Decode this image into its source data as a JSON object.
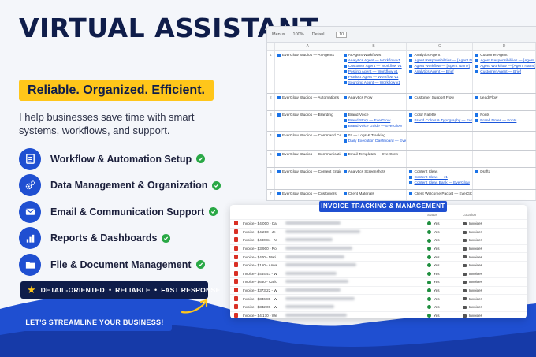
{
  "header": {
    "title": "VIRTUAL ASSISTANT",
    "tagline": "Reliable. Organized. Efficient.",
    "intro": "I help businesses save time with smart systems, workflows, and support."
  },
  "services": [
    {
      "label": "Workflow & Automation Setup",
      "icon": "checklist-icon"
    },
    {
      "label": "Data Management & Organization",
      "icon": "gears-icon"
    },
    {
      "label": "Email & Communication Support",
      "icon": "envelope-icon"
    },
    {
      "label": "Reports & Dashboards",
      "icon": "bar-chart-icon"
    },
    {
      "label": "File & Document Management",
      "icon": "folder-icon"
    }
  ],
  "qualities": [
    "DETAIL-ORIENTED",
    "RELIABLE",
    "FAST RESPONSE"
  ],
  "cta": "LET'S STREAMLINE YOUR BUSINESS!",
  "colors": {
    "navy": "#0f1d4a",
    "blue": "#1f4fd1",
    "yellow": "#ffc61a",
    "green": "#29a845"
  },
  "sheet": {
    "toolbar": [
      "Menus",
      "100%",
      "Defaul...",
      "10"
    ],
    "columns": [
      "A",
      "B",
      "C",
      "D"
    ],
    "rows": [
      {
        "num": "1",
        "cells": [
          [
            "EverGlow Studios — AI Agents"
          ],
          [
            "AI Agent Workflows",
            "Analytics Agent — Workflow v1",
            "Customer Agent — Workflow v1",
            "Posting Agent — Workflow v1",
            "Product Agent — Workflow v1",
            "Sourcing Agent — Workflow v1"
          ],
          [
            "Analytics Agent",
            "Agent Responsibilities — [Agent Name]",
            "Agent Workflow — [Agent Name]",
            "Analytics Agent — Brief"
          ],
          [
            "Customer Agent",
            "Agent Responsibilities — [Agent Name]",
            "Agent Workflow — [Agent Name]",
            "Customer Agent — Brief"
          ]
        ]
      },
      {
        "num": "2",
        "cells": [
          [
            "EverGlow Studios — Automations"
          ],
          [
            "Analytics Flow"
          ],
          [
            "Customer Support Flow"
          ],
          [
            "Lead Flow"
          ]
        ]
      },
      {
        "num": "3",
        "cells": [
          [
            "EverGlow Studios — Branding"
          ],
          [
            "Brand Voice",
            "Brand Story — EverGlow",
            "Brand Voice Guide — EverGlow"
          ],
          [
            "Color Palette",
            "Brand Colors & Typography — EverGlow"
          ],
          [
            "Fonts",
            "Brand Notes — Fonts"
          ]
        ]
      },
      {
        "num": "4",
        "cells": [
          [
            "EverGlow Studios — Command Center"
          ],
          [
            "07 — Logs & Tracking",
            "Daily Execution Dashboard — EverGlow Studios"
          ],
          [
            ""
          ],
          [
            ""
          ]
        ]
      },
      {
        "num": "5",
        "cells": [
          [
            "EverGlow Studios — Communications"
          ],
          [
            "Email Templates — EverGlow"
          ],
          [
            ""
          ],
          [
            ""
          ]
        ]
      },
      {
        "num": "6",
        "cells": [
          [
            "EverGlow Studios — Content Engine"
          ],
          [
            "Analytics Screenshots"
          ],
          [
            "Content Ideas",
            "Content Ideas — v1",
            "Content Ideas Bank — EverGlow"
          ],
          [
            "Drafts"
          ]
        ]
      },
      {
        "num": "7",
        "cells": [
          [
            "EverGlow Studios — Customers"
          ],
          [
            "Client Materials"
          ],
          [
            "Client Welcome Packet — EverGlow"
          ],
          [
            ""
          ]
        ]
      }
    ]
  },
  "invoice": {
    "title": "INVOICE TRACKING & MANAGEMENT",
    "headers": [
      "Status",
      "Location"
    ],
    "rows": [
      {
        "name": "Invoice - $4,000 - Ca",
        "status": "Yes",
        "location": "Invoices"
      },
      {
        "name": "Invoice - $4,200 - Je",
        "status": "Yes",
        "location": "Invoices"
      },
      {
        "name": "Invoice - $480.84 - N",
        "status": "Yes",
        "location": "Invoices"
      },
      {
        "name": "Invoice - $3,900 - Ro",
        "status": "Yes",
        "location": "Invoices"
      },
      {
        "name": "Invoice - $400 - Mari",
        "status": "Yes",
        "location": "Invoices"
      },
      {
        "name": "Invoice - $150 - Anna",
        "status": "Yes",
        "location": "Invoices"
      },
      {
        "name": "Invoice - $454.41 - W",
        "status": "Yes",
        "location": "Invoices"
      },
      {
        "name": "Invoice - $680 - Carlo",
        "status": "Yes",
        "location": "Invoices"
      },
      {
        "name": "Invoice - $373.22 - W",
        "status": "Yes",
        "location": "Invoices"
      },
      {
        "name": "Invoice - $346.88 - W",
        "status": "Yes",
        "location": "Invoices"
      },
      {
        "name": "Invoice - $342.06 - W",
        "status": "Yes",
        "location": "Invoices"
      },
      {
        "name": "Invoice - $4,170 - We",
        "status": "Yes",
        "location": "Invoices"
      },
      {
        "name": "Invoice - $4,000 - Ca",
        "status": "Yes",
        "location": "Invoices"
      },
      {
        "name": "Invoice - $57.11 - Wei",
        "status": "Yes",
        "location": "Invoices"
      },
      {
        "name": "Finance Invoice - Vea",
        "status": "Yes",
        "location": "Contracts"
      }
    ]
  }
}
